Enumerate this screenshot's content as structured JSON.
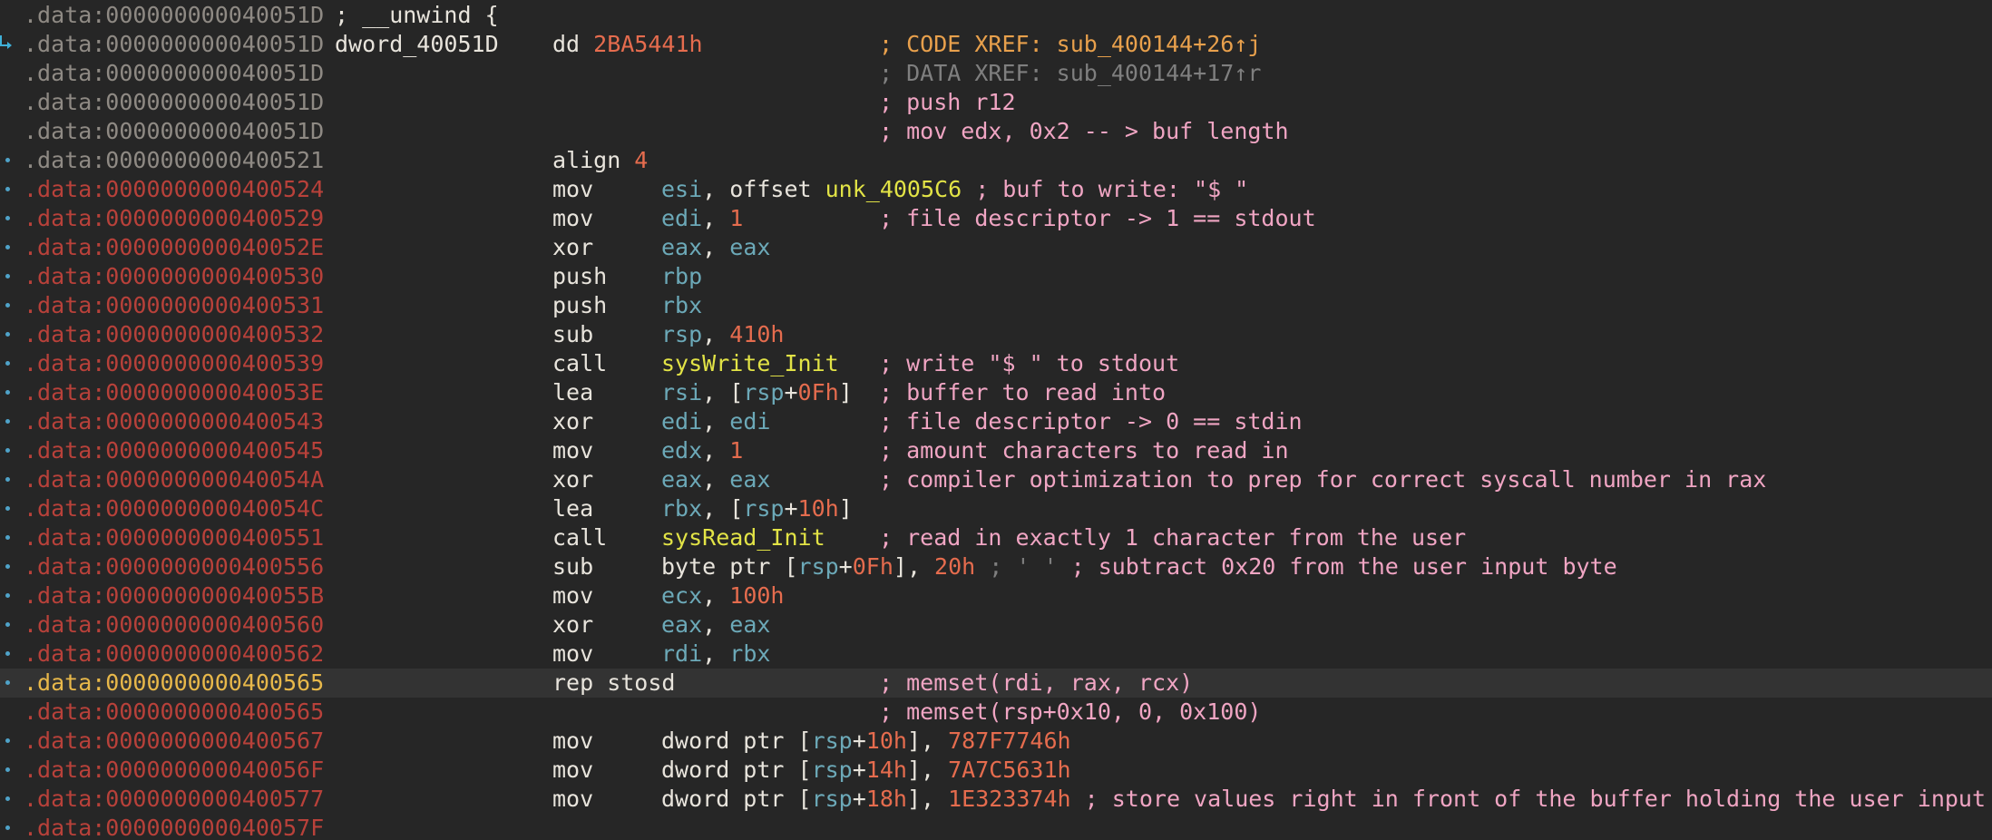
{
  "lines": [
    {
      "addr": ".data:000000000040051D",
      "addr_style": "norm",
      "mark": false,
      "arrow": false,
      "label": "",
      "mnem": "",
      "ops": [],
      "comment": [
        {
          "t": "; __unwind {",
          "s": "mnem"
        }
      ],
      "comment_col": "label",
      "hl": false
    },
    {
      "addr": ".data:000000000040051D",
      "addr_style": "norm",
      "mark": false,
      "arrow": true,
      "label": "dword_40051D",
      "mnem": "dd",
      "ops": [
        {
          "t": "2BA5441h",
          "s": "num",
          "col": "mnem2"
        }
      ],
      "comment": [
        {
          "t": "; CODE XREF: sub_400144+26↑j",
          "s": "cmt-h"
        }
      ],
      "hl": false
    },
    {
      "addr": ".data:000000000040051D",
      "addr_style": "norm",
      "mark": false,
      "arrow": false,
      "label": "",
      "mnem": "",
      "ops": [],
      "comment": [
        {
          "t": "; DATA XREF: sub_400144+17↑r",
          "s": "cmt-g"
        }
      ],
      "hl": false
    },
    {
      "addr": ".data:000000000040051D",
      "addr_style": "norm",
      "mark": false,
      "arrow": false,
      "label": "",
      "mnem": "",
      "ops": [],
      "comment": [
        {
          "t": "; push r12",
          "s": "cmt"
        }
      ],
      "hl": false
    },
    {
      "addr": ".data:000000000040051D",
      "addr_style": "norm",
      "mark": false,
      "arrow": false,
      "label": "",
      "mnem": "",
      "ops": [],
      "comment": [
        {
          "t": "; mov edx, 0x2 -- > buf length",
          "s": "cmt"
        }
      ],
      "hl": false
    },
    {
      "addr": ".data:0000000000400521",
      "addr_style": "norm",
      "mark": true,
      "arrow": false,
      "label": "",
      "mnem": "align",
      "ops": [
        {
          "t": "4",
          "s": "num",
          "col": "mnem2"
        }
      ],
      "comment": [],
      "hl": false
    },
    {
      "addr": ".data:0000000000400524",
      "addr_style": "red",
      "mark": true,
      "arrow": false,
      "label": "",
      "mnem": "mov",
      "ops": [
        {
          "t": "esi",
          "s": "reg"
        },
        {
          "t": ", offset ",
          "s": "punc"
        },
        {
          "t": "unk_4005C6",
          "s": "sym"
        },
        {
          "t": " ",
          "s": "punc"
        }
      ],
      "comment": [
        {
          "t": "; buf to write: \"$ \"",
          "s": "cmt",
          "inline": true
        }
      ],
      "hl": false
    },
    {
      "addr": ".data:0000000000400529",
      "addr_style": "red",
      "mark": true,
      "arrow": false,
      "label": "",
      "mnem": "mov",
      "ops": [
        {
          "t": "edi",
          "s": "reg"
        },
        {
          "t": ", ",
          "s": "punc"
        },
        {
          "t": "1",
          "s": "num"
        }
      ],
      "comment": [
        {
          "t": "; file descriptor -> 1 == stdout",
          "s": "cmt"
        }
      ],
      "hl": false
    },
    {
      "addr": ".data:000000000040052E",
      "addr_style": "red",
      "mark": true,
      "arrow": false,
      "label": "",
      "mnem": "xor",
      "ops": [
        {
          "t": "eax",
          "s": "reg"
        },
        {
          "t": ", ",
          "s": "punc"
        },
        {
          "t": "eax",
          "s": "reg"
        }
      ],
      "comment": [],
      "hl": false
    },
    {
      "addr": ".data:0000000000400530",
      "addr_style": "red",
      "mark": true,
      "arrow": false,
      "label": "",
      "mnem": "push",
      "ops": [
        {
          "t": "rbp",
          "s": "reg"
        }
      ],
      "comment": [],
      "hl": false
    },
    {
      "addr": ".data:0000000000400531",
      "addr_style": "red",
      "mark": true,
      "arrow": false,
      "label": "",
      "mnem": "push",
      "ops": [
        {
          "t": "rbx",
          "s": "reg"
        }
      ],
      "comment": [],
      "hl": false
    },
    {
      "addr": ".data:0000000000400532",
      "addr_style": "red",
      "mark": true,
      "arrow": false,
      "label": "",
      "mnem": "sub",
      "ops": [
        {
          "t": "rsp",
          "s": "reg"
        },
        {
          "t": ", ",
          "s": "punc"
        },
        {
          "t": "410h",
          "s": "num"
        }
      ],
      "comment": [],
      "hl": false
    },
    {
      "addr": ".data:0000000000400539",
      "addr_style": "red",
      "mark": true,
      "arrow": false,
      "label": "",
      "mnem": "call",
      "ops": [
        {
          "t": "sysWrite_Init",
          "s": "sym"
        }
      ],
      "comment": [
        {
          "t": "; write \"$ \" to stdout",
          "s": "cmt"
        }
      ],
      "hl": false
    },
    {
      "addr": ".data:000000000040053E",
      "addr_style": "red",
      "mark": true,
      "arrow": false,
      "label": "",
      "mnem": "lea",
      "ops": [
        {
          "t": "rsi",
          "s": "reg"
        },
        {
          "t": ", [",
          "s": "punc"
        },
        {
          "t": "rsp",
          "s": "reg"
        },
        {
          "t": "+",
          "s": "punc"
        },
        {
          "t": "0Fh",
          "s": "num"
        },
        {
          "t": "]",
          "s": "punc"
        }
      ],
      "comment": [
        {
          "t": "; buffer to read into",
          "s": "cmt"
        }
      ],
      "hl": false
    },
    {
      "addr": ".data:0000000000400543",
      "addr_style": "red",
      "mark": true,
      "arrow": false,
      "label": "",
      "mnem": "xor",
      "ops": [
        {
          "t": "edi",
          "s": "reg"
        },
        {
          "t": ", ",
          "s": "punc"
        },
        {
          "t": "edi",
          "s": "reg"
        }
      ],
      "comment": [
        {
          "t": "; file descriptor -> 0 == stdin",
          "s": "cmt"
        }
      ],
      "hl": false
    },
    {
      "addr": ".data:0000000000400545",
      "addr_style": "red",
      "mark": true,
      "arrow": false,
      "label": "",
      "mnem": "mov",
      "ops": [
        {
          "t": "edx",
          "s": "reg"
        },
        {
          "t": ", ",
          "s": "punc"
        },
        {
          "t": "1",
          "s": "num"
        }
      ],
      "comment": [
        {
          "t": "; amount characters to read in",
          "s": "cmt"
        }
      ],
      "hl": false
    },
    {
      "addr": ".data:000000000040054A",
      "addr_style": "red",
      "mark": true,
      "arrow": false,
      "label": "",
      "mnem": "xor",
      "ops": [
        {
          "t": "eax",
          "s": "reg"
        },
        {
          "t": ", ",
          "s": "punc"
        },
        {
          "t": "eax",
          "s": "reg"
        }
      ],
      "comment": [
        {
          "t": "; compiler optimization to prep for correct syscall number in rax",
          "s": "cmt"
        }
      ],
      "hl": false
    },
    {
      "addr": ".data:000000000040054C",
      "addr_style": "red",
      "mark": true,
      "arrow": false,
      "label": "",
      "mnem": "lea",
      "ops": [
        {
          "t": "rbx",
          "s": "reg"
        },
        {
          "t": ", [",
          "s": "punc"
        },
        {
          "t": "rsp",
          "s": "reg"
        },
        {
          "t": "+",
          "s": "punc"
        },
        {
          "t": "10h",
          "s": "num"
        },
        {
          "t": "]",
          "s": "punc"
        }
      ],
      "comment": [],
      "hl": false
    },
    {
      "addr": ".data:0000000000400551",
      "addr_style": "red",
      "mark": true,
      "arrow": false,
      "label": "",
      "mnem": "call",
      "ops": [
        {
          "t": "sysRead_Init",
          "s": "sym"
        }
      ],
      "comment": [
        {
          "t": "; read in exactly 1 character from the user",
          "s": "cmt"
        }
      ],
      "hl": false
    },
    {
      "addr": ".data:0000000000400556",
      "addr_style": "red",
      "mark": true,
      "arrow": false,
      "label": "",
      "mnem": "sub",
      "ops": [
        {
          "t": "byte ptr [",
          "s": "punc"
        },
        {
          "t": "rsp",
          "s": "reg"
        },
        {
          "t": "+",
          "s": "punc"
        },
        {
          "t": "0Fh",
          "s": "num"
        },
        {
          "t": "], ",
          "s": "punc"
        },
        {
          "t": "20h",
          "s": "num"
        },
        {
          "t": " ",
          "s": "punc"
        },
        {
          "t": "; ' '",
          "s": "cmt-g"
        },
        {
          "t": " ",
          "s": "punc"
        }
      ],
      "comment": [
        {
          "t": "; subtract 0x20 from the user input byte",
          "s": "cmt",
          "inline": true
        }
      ],
      "hl": false
    },
    {
      "addr": ".data:000000000040055B",
      "addr_style": "red",
      "mark": true,
      "arrow": false,
      "label": "",
      "mnem": "mov",
      "ops": [
        {
          "t": "ecx",
          "s": "reg"
        },
        {
          "t": ", ",
          "s": "punc"
        },
        {
          "t": "100h",
          "s": "num"
        }
      ],
      "comment": [],
      "hl": false
    },
    {
      "addr": ".data:0000000000400560",
      "addr_style": "red",
      "mark": true,
      "arrow": false,
      "label": "",
      "mnem": "xor",
      "ops": [
        {
          "t": "eax",
          "s": "reg"
        },
        {
          "t": ", ",
          "s": "punc"
        },
        {
          "t": "eax",
          "s": "reg"
        }
      ],
      "comment": [],
      "hl": false
    },
    {
      "addr": ".data:0000000000400562",
      "addr_style": "red",
      "mark": true,
      "arrow": false,
      "label": "",
      "mnem": "mov",
      "ops": [
        {
          "t": "rdi",
          "s": "reg"
        },
        {
          "t": ", ",
          "s": "punc"
        },
        {
          "t": "rbx",
          "s": "reg"
        }
      ],
      "comment": [],
      "hl": false
    },
    {
      "addr": ".data:0000000000400565",
      "addr_style": "cur",
      "mark": true,
      "arrow": false,
      "label": "",
      "mnem": "rep stosd",
      "ops": [],
      "comment": [
        {
          "t": "; memset(rdi, rax, rcx)",
          "s": "cmt"
        }
      ],
      "hl": true
    },
    {
      "addr": ".data:0000000000400565",
      "addr_style": "red",
      "mark": false,
      "arrow": false,
      "label": "",
      "mnem": "",
      "ops": [],
      "comment": [
        {
          "t": "; memset(rsp+0x10, 0, 0x100)",
          "s": "cmt"
        }
      ],
      "hl": false
    },
    {
      "addr": ".data:0000000000400567",
      "addr_style": "red",
      "mark": true,
      "arrow": false,
      "label": "",
      "mnem": "mov",
      "ops": [
        {
          "t": "dword ptr [",
          "s": "punc"
        },
        {
          "t": "rsp",
          "s": "reg"
        },
        {
          "t": "+",
          "s": "punc"
        },
        {
          "t": "10h",
          "s": "num"
        },
        {
          "t": "], ",
          "s": "punc"
        },
        {
          "t": "787F7746h",
          "s": "num"
        }
      ],
      "comment": [],
      "hl": false
    },
    {
      "addr": ".data:000000000040056F",
      "addr_style": "red",
      "mark": true,
      "arrow": false,
      "label": "",
      "mnem": "mov",
      "ops": [
        {
          "t": "dword ptr [",
          "s": "punc"
        },
        {
          "t": "rsp",
          "s": "reg"
        },
        {
          "t": "+",
          "s": "punc"
        },
        {
          "t": "14h",
          "s": "num"
        },
        {
          "t": "], ",
          "s": "punc"
        },
        {
          "t": "7A7C5631h",
          "s": "num"
        }
      ],
      "comment": [],
      "hl": false
    },
    {
      "addr": ".data:0000000000400577",
      "addr_style": "red",
      "mark": true,
      "arrow": false,
      "label": "",
      "mnem": "mov",
      "ops": [
        {
          "t": "dword ptr [",
          "s": "punc"
        },
        {
          "t": "rsp",
          "s": "reg"
        },
        {
          "t": "+",
          "s": "punc"
        },
        {
          "t": "18h",
          "s": "num"
        },
        {
          "t": "], ",
          "s": "punc"
        },
        {
          "t": "1E323374h",
          "s": "num"
        },
        {
          "t": " ",
          "s": "punc"
        }
      ],
      "comment": [
        {
          "t": "; store values right in front of the buffer holding the user input",
          "s": "cmt",
          "inline": true
        }
      ],
      "hl": false
    },
    {
      "addr": ".data:000000000040057F",
      "addr_style": "red",
      "mark": true,
      "arrow": false,
      "label": "",
      "mnem": "",
      "ops": [],
      "comment": [],
      "hl": false
    }
  ]
}
